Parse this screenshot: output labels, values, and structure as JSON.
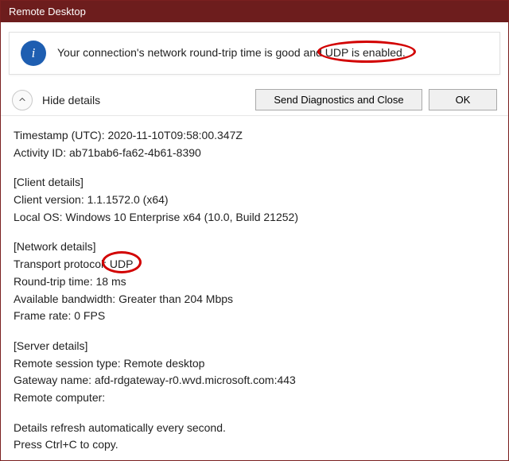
{
  "title": "Remote Desktop",
  "banner": {
    "icon_glyph": "i",
    "text_before": "Your connection's network round-trip time is good and ",
    "text_highlight": "UDP is enabled.",
    "text_after": ""
  },
  "buttons": {
    "hide_details": "Hide details",
    "send_close": "Send Diagnostics and Close",
    "ok": "OK"
  },
  "details": {
    "timestamp_label": "Timestamp (UTC): ",
    "timestamp_value": "2020-11-10T09:58:00.347Z",
    "activity_label": "Activity ID: ",
    "activity_value": "ab71bab6-fa62-4b61-8390",
    "client_header": "[Client details]",
    "client_version_label": "Client version: ",
    "client_version_value": "1.1.1572.0 (x64)",
    "local_os_label": "Local OS: ",
    "local_os_value": "Windows 10 Enterprise x64 (10.0, Build 21252)",
    "network_header": "[Network details]",
    "transport_label": "Transport protocol: ",
    "transport_value": "UDP",
    "rtt_label": "Round-trip time: ",
    "rtt_value": "18 ms",
    "bandwidth_label": "Available bandwidth: ",
    "bandwidth_value": "Greater than 204 Mbps",
    "framerate_label": "Frame rate: ",
    "framerate_value": "0 FPS",
    "server_header": "[Server details]",
    "session_type_label": "Remote session type: ",
    "session_type_value": "Remote desktop",
    "gateway_label": "Gateway name: ",
    "gateway_value": "afd-rdgateway-r0.wvd.microsoft.com:443",
    "remote_computer_label": "Remote computer:",
    "remote_computer_value": "",
    "refresh_text": "Details refresh automatically every second.",
    "copy_text": "Press Ctrl+C to copy."
  }
}
